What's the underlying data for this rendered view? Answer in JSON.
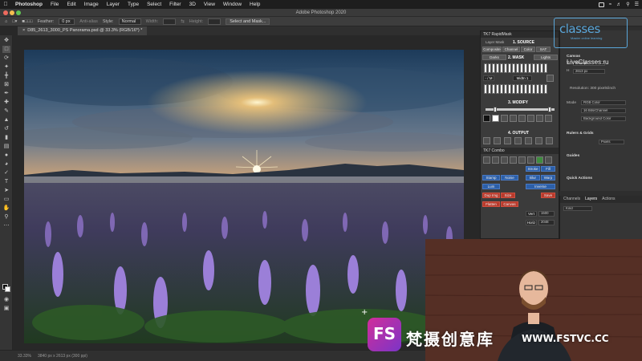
{
  "menubar": {
    "app": "Photoshop",
    "items": [
      "File",
      "Edit",
      "Image",
      "Layer",
      "Type",
      "Select",
      "Filter",
      "3D",
      "View",
      "Window",
      "Help"
    ]
  },
  "titlebar": {
    "title": "Adobe Photoshop 2020"
  },
  "options": {
    "feather_label": "Feather:",
    "feather_value": "0 px",
    "antialias_label": "Anti-alias",
    "style_label": "Style:",
    "style_value": "Normal",
    "width_label": "Width:",
    "height_label": "Height:",
    "select_mask_button": "Select and Mask..."
  },
  "document": {
    "tab": "D85_2613_3000_PS Panorama.psd @ 33.3% (RGB/16*) *"
  },
  "status": {
    "zoom": "33.33%",
    "doc_size": "3840 px x 2613 px (300 ppi)"
  },
  "tk7": {
    "title": "TK7 RapidMask",
    "sub_tab": "Layer Mask",
    "source_header": "1. SOURCE",
    "source_tabs": [
      "Composite",
      "Channel",
      "Color",
      "SAT"
    ],
    "mask_header": "2. MASK",
    "mask_left": "Darks",
    "mask_right": "Lights",
    "mask_btn": "Midtn 1",
    "modify_header": "3. MODIFY",
    "output_header": "4. OUTPUT",
    "combo_title": "TK7 Combo",
    "combo_buttons": [
      "Stroke",
      "Fill",
      "Stamp",
      "Blur",
      "Noise",
      "Warp",
      "Lum",
      "Inverse",
      "Dup Img",
      "Size",
      "Save",
      "Flatten",
      "Canvas",
      "Vert",
      "Horiz"
    ],
    "numbers": [
      "1500",
      "2048"
    ]
  },
  "properties": {
    "section_canvas": "Canvas",
    "width_value": "3840 px",
    "height_value": "2613 px",
    "resolution_label": "Resolution: 300 pixels/inch",
    "mode_label": "Mode",
    "mode_value": "RGB Color",
    "bitdepth_value": "16 Bits/Channel",
    "fill_value": "Background Color",
    "rulers_grids": "Rulers & Grids",
    "guides": "Guides",
    "quick_actions": "Quick Actions",
    "pixels_unit": "Pixels"
  },
  "layers": {
    "tabs": [
      "Channels",
      "Layers",
      "Actions"
    ],
    "active": "Layers",
    "kind": "Kind"
  },
  "watermarks": {
    "lc_brand": "classes",
    "lc_sub": "Master online learning",
    "lc_site": "LiveClasses.ru",
    "fs_mark": "FS",
    "fs_cn": "梵摄创意库",
    "fs_url": "WWW.FSTVC.CC"
  },
  "colors": {
    "ui_bg": "#282828",
    "panel": "#3b3b3b",
    "lc_blue": "#5aa6d9",
    "fs_pink": "#d12d9a"
  }
}
